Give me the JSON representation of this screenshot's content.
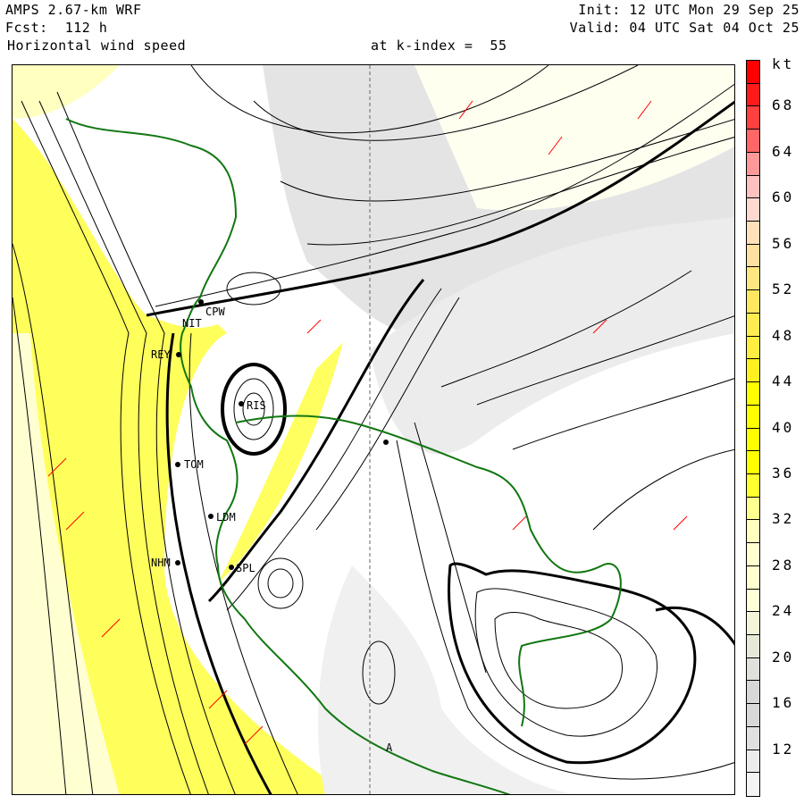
{
  "header": {
    "model": "AMPS 2.67-km WRF",
    "forecast": "Fcst:  112 h",
    "field": "Horizontal wind speed",
    "level": "at k-index =  55",
    "init": "Init: 12 UTC Mon 29 Sep 25",
    "valid": "Valid: 04 UTC Sat 04 Oct 25"
  },
  "colorbar": {
    "unit": "kt",
    "labels": [
      "68",
      "64",
      "60",
      "56",
      "52",
      "48",
      "44",
      "40",
      "36",
      "32",
      "28",
      "24",
      "20",
      "16",
      "12"
    ],
    "colors": [
      "#ff0000",
      "#ff1a1a",
      "#ff4040",
      "#ff6666",
      "#ff9999",
      "#ffc0c0",
      "#ffd8d0",
      "#ffe0b8",
      "#ffe0a0",
      "#ffe680",
      "#ffe860",
      "#ffec50",
      "#ffee40",
      "#fff020",
      "#ffff00",
      "#ffff00",
      "#ffff00",
      "#ffff00",
      "#ffff30",
      "#ffff90",
      "#ffffc0",
      "#ffffd0",
      "#ffffd0",
      "#ffffd8",
      "#f4f4d8",
      "#e8e8d8",
      "#e0e0dc",
      "#d8d8d8",
      "#d8d8d8",
      "#e0e0e0",
      "#ececec",
      "#f4f4f4"
    ]
  },
  "stations": [
    {
      "id": "CPW"
    },
    {
      "id": "NIT"
    },
    {
      "id": "REY"
    },
    {
      "id": "RIS"
    },
    {
      "id": "TOM"
    },
    {
      "id": "LDM"
    },
    {
      "id": "NHM"
    },
    {
      "id": "SPL"
    },
    {
      "id": "A"
    }
  ]
}
